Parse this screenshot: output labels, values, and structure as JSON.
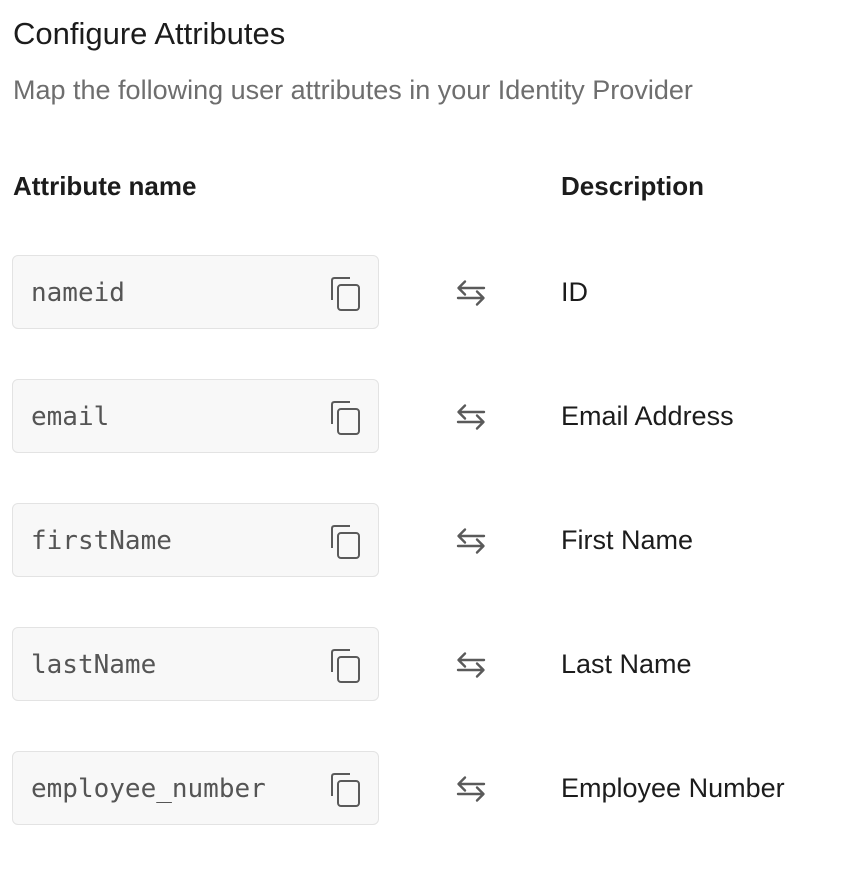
{
  "header": {
    "title": "Configure Attributes",
    "subtitle": "Map the following user attributes in your Identity Provider"
  },
  "columns": {
    "attribute": "Attribute name",
    "description": "Description"
  },
  "rows": [
    {
      "attribute": "nameid",
      "description": "ID"
    },
    {
      "attribute": "email",
      "description": "Email Address"
    },
    {
      "attribute": "firstName",
      "description": "First Name"
    },
    {
      "attribute": "lastName",
      "description": "Last Name"
    },
    {
      "attribute": "employee_number",
      "description": "Employee Number"
    }
  ],
  "icons": {
    "copy": "copy-icon",
    "mapping": "swap-arrows-icon"
  },
  "colors": {
    "field_background": "#f8f8f8",
    "field_border": "#e3e3e3",
    "icon": "#5a5a5a",
    "muted_text": "#6e6e6e"
  }
}
